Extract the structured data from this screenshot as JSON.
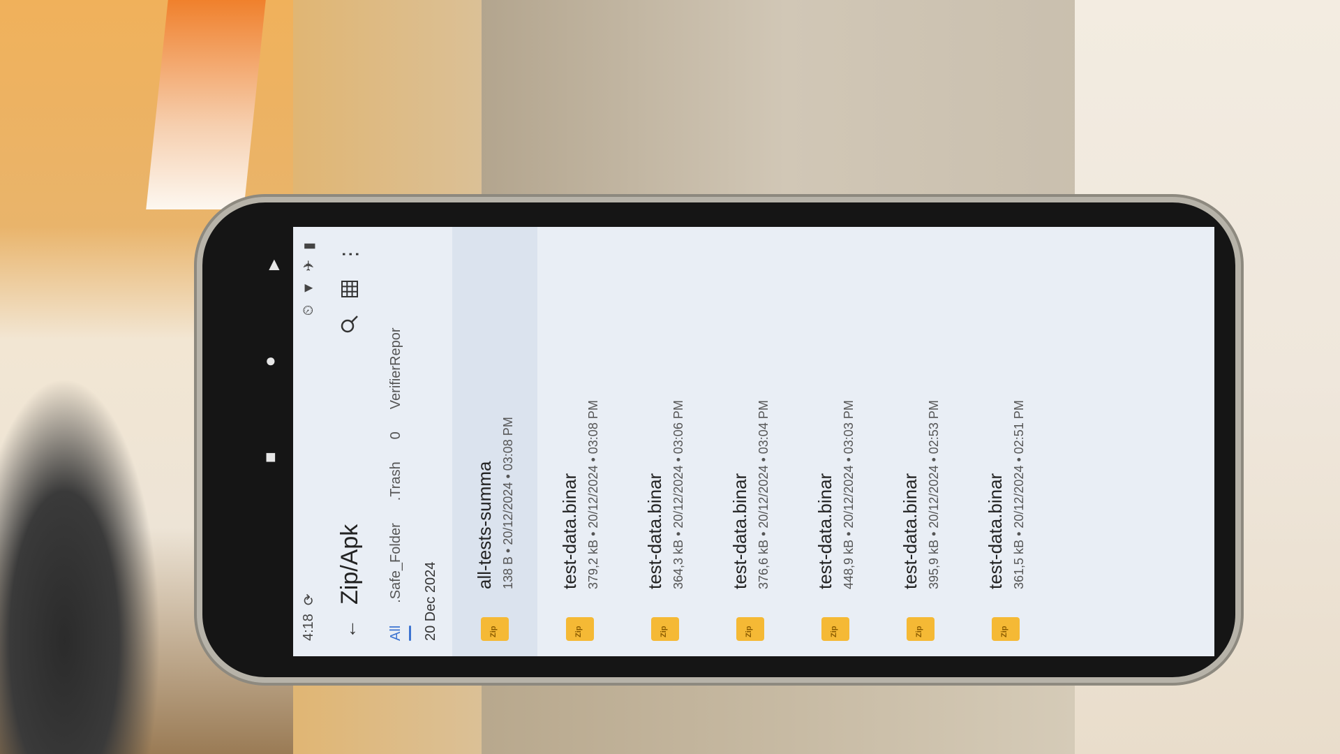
{
  "status_bar": {
    "time": "4:18",
    "icons": [
      "sync-icon",
      "alarm-icon",
      "wifi-icon",
      "airplane-icon",
      "battery-icon"
    ]
  },
  "toolbar": {
    "back_icon": "arrow-left-icon",
    "title": "Zip/Apk",
    "search_icon": "search-icon",
    "grid_icon": "grid-view-icon",
    "more_icon": "more-vertical-icon"
  },
  "tabs": [
    {
      "label": "All",
      "active": true
    },
    {
      "label": ".Safe_Folder",
      "active": false
    },
    {
      "label": ".Trash",
      "active": false
    },
    {
      "label": "0",
      "active": false
    },
    {
      "label": "VerifierRepor",
      "active": false
    }
  ],
  "date_header": "20 Dec 2024",
  "files": [
    {
      "name": "all-tests-summa",
      "size": "138 B",
      "date": "20/12/2024",
      "time": "03:08 PM"
    },
    {
      "name": "test-data.binar",
      "size": "379,2 kB",
      "date": "20/12/2024",
      "time": "03:08 PM"
    },
    {
      "name": "test-data.binar",
      "size": "364,3 kB",
      "date": "20/12/2024",
      "time": "03:06 PM"
    },
    {
      "name": "test-data.binar",
      "size": "376,6 kB",
      "date": "20/12/2024",
      "time": "03:04 PM"
    },
    {
      "name": "test-data.binar",
      "size": "448,9 kB",
      "date": "20/12/2024",
      "time": "03:03 PM"
    },
    {
      "name": "test-data.binar",
      "size": "395,9 kB",
      "date": "20/12/2024",
      "time": "02:53 PM"
    },
    {
      "name": "test-data.binar",
      "size": "361,5 kB",
      "date": "20/12/2024",
      "time": "02:51 PM"
    }
  ],
  "nav_buttons": [
    "back-triangle-icon",
    "home-circle-icon",
    "recents-square-icon"
  ],
  "colors": {
    "accent": "#3d74d1",
    "zip_icon": "#f5b935",
    "background": "#e9eef5"
  }
}
